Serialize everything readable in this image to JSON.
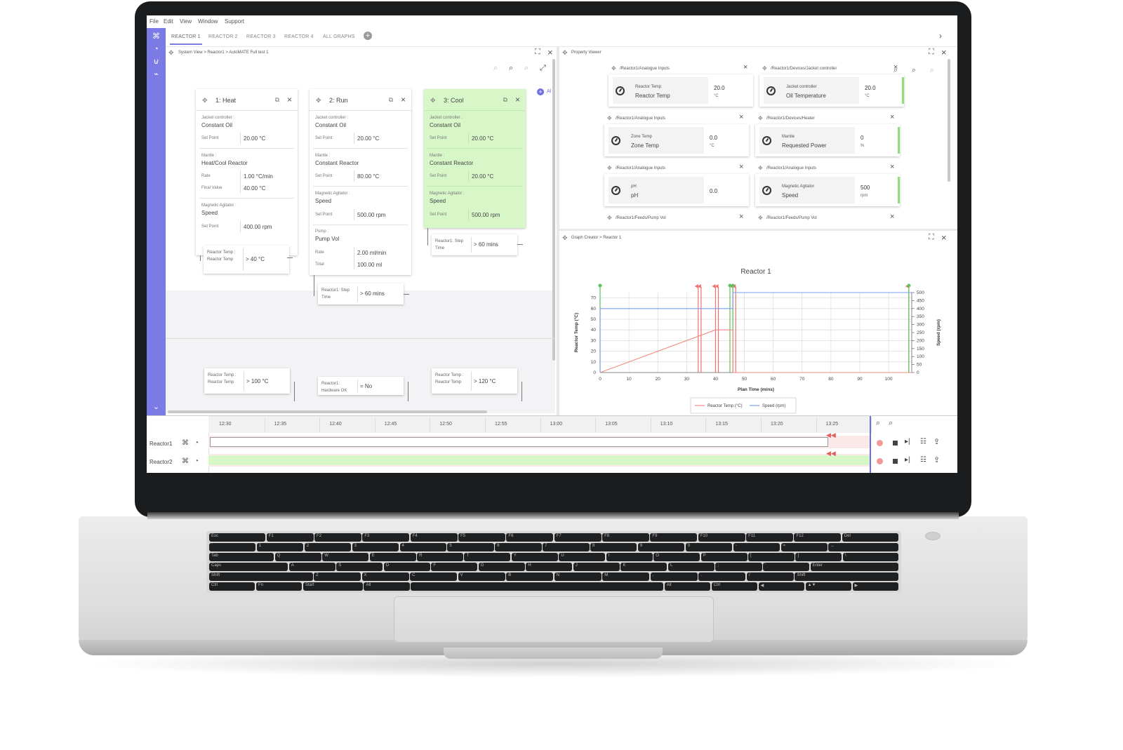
{
  "app": {
    "menu": [
      "File",
      "Edit",
      "View",
      "Window",
      "Support"
    ],
    "tabs": [
      "REACTOR 1",
      "REACTOR 2",
      "REACTOR 3",
      "REACTOR 4",
      "ALL GRAPHS"
    ],
    "active_tab": "REACTOR 1",
    "accent_color": "#7b7be6",
    "active_step_color": "#d8f7c9"
  },
  "system_view": {
    "breadcrumb": "System View > Reactor1 > AutoMATE Full test 1",
    "add_label": "Al",
    "steps": [
      {
        "title": "1: Heat",
        "sections": [
          {
            "device": "Jacket controller :",
            "mode": "Constant Oil",
            "rows": [
              {
                "label": "Set Point",
                "value": "20.00 °C"
              }
            ]
          },
          {
            "device": "Mantle :",
            "mode": "Heat/Cool Reactor",
            "rows": [
              {
                "label": "Rate",
                "value": "1.00 °C/min"
              },
              {
                "label": "Final Value",
                "value": "40.00 °C"
              }
            ]
          },
          {
            "device": "Magnetic Agitator :",
            "mode": "Speed",
            "rows": [
              {
                "label": "Set Point",
                "value": "400.00 rpm"
              }
            ]
          }
        ],
        "condition": {
          "label": "Reactor Temp : Reactor Temp",
          "value": "> 40 °C"
        }
      },
      {
        "title": "2: Run",
        "sections": [
          {
            "device": "Jacket controller :",
            "mode": "Constant Oil",
            "rows": [
              {
                "label": "Set Point",
                "value": "20.00 °C"
              }
            ]
          },
          {
            "device": "Mantle :",
            "mode": "Constant Reactor",
            "rows": [
              {
                "label": "Set Point",
                "value": "80.00 °C"
              }
            ]
          },
          {
            "device": "Magnetic Agitator :",
            "mode": "Speed",
            "rows": [
              {
                "label": "Set Point",
                "value": "500.00 rpm"
              }
            ]
          },
          {
            "device": "Pump :",
            "mode": "Pump Vol",
            "rows": [
              {
                "label": "Rate",
                "value": "2.00 ml/min"
              },
              {
                "label": "Total",
                "value": "100.00 ml"
              }
            ]
          }
        ],
        "condition": {
          "label": "Reactor1: Step Time",
          "value": "> 60 mins"
        }
      },
      {
        "title": "3: Cool",
        "sections": [
          {
            "device": "Jacket controller :",
            "mode": "Constant Oil",
            "rows": [
              {
                "label": "Set Point",
                "value": "20.00 °C"
              }
            ]
          },
          {
            "device": "Mantle :",
            "mode": "Constant Reactor",
            "rows": [
              {
                "label": "Set Point",
                "value": "20.00 °C"
              }
            ]
          },
          {
            "device": "Magnetic Agitator :",
            "mode": "Speed",
            "rows": [
              {
                "label": "Set Point",
                "value": "500.00 rpm"
              }
            ]
          }
        ],
        "condition": {
          "label": "Reactor1: Step Time",
          "value": "> 60 mins"
        }
      }
    ],
    "lower_conditions": [
      {
        "label": "Reactor Temp : Reactor Temp",
        "value": "> 100 °C"
      },
      {
        "label": "Reactor1: Hardware OK",
        "value": "= No"
      },
      {
        "label": "Reactor Temp : Reactor Temp",
        "value": "> 120 °C"
      }
    ]
  },
  "property_viewer": {
    "title": "Property Viewer",
    "cards": [
      {
        "path": "/Reactor1/Analogue Inputs",
        "device": "Reactor Temp",
        "property": "Reactor Temp",
        "value": "20.0",
        "unit": "°C"
      },
      {
        "path": "/Reactor1/Devices/Jacket controller",
        "device": "Jacket controller",
        "property": "Oil Temperature",
        "value": "20.0",
        "unit": "°C"
      },
      {
        "path": "/Reactor1/Analogue Inputs",
        "device": "Zone Temp",
        "property": "Zone Temp",
        "value": "0.0",
        "unit": "°C"
      },
      {
        "path": "/Reactor1/Devices/Heater",
        "device": "Mantle",
        "property": "Requested Power",
        "value": "0",
        "unit": "%"
      },
      {
        "path": "/Reactor1/Analogue Inputs",
        "device": "pH",
        "property": "pH",
        "value": "0.0",
        "unit": ""
      },
      {
        "path": "/Reactor1/Analogue Inputs",
        "device": "Magnetic Agitator",
        "property": "Speed",
        "value": "500",
        "unit": "rpm"
      },
      {
        "path": "/Reactor1/Feeds/Pump Vol",
        "device": "",
        "property": "",
        "value": "",
        "unit": ""
      },
      {
        "path": "/Reactor1/Feeds/Pump Vol",
        "device": "",
        "property": "",
        "value": "",
        "unit": ""
      }
    ]
  },
  "graph_creator": {
    "breadcrumb": "Graph Creator > Reactor 1"
  },
  "chart_data": {
    "type": "line",
    "title": "Reactor 1",
    "xlabel": "Plan Time (mins)",
    "ylabel": "Reactor Temp (°C)",
    "y2label": "Speed (rpm)",
    "xlim": [
      0,
      108
    ],
    "ylim": [
      0,
      75
    ],
    "y2lim": [
      0,
      500
    ],
    "xticks": [
      0,
      10,
      20,
      30,
      40,
      50,
      60,
      70,
      80,
      90,
      100
    ],
    "yticks": [
      0,
      10,
      20,
      30,
      40,
      50,
      60,
      70
    ],
    "y2ticks": [
      0,
      50,
      100,
      150,
      200,
      250,
      300,
      350,
      400,
      450,
      500
    ],
    "grid": true,
    "legend_position": "bottom",
    "series": [
      {
        "name": "Reactor Temp (°C)",
        "color": "#f28b82",
        "axis": "left",
        "x": [
          0,
          40,
          46,
          46,
          108
        ],
        "y": [
          0,
          40,
          40,
          0,
          0
        ]
      },
      {
        "name": "Speed (rpm)",
        "color": "#7b9ff0",
        "axis": "right",
        "x": [
          0,
          0,
          7,
          7,
          46,
          46,
          108
        ],
        "y": [
          0,
          400,
          400,
          400,
          400,
          500,
          500
        ]
      }
    ],
    "markers_red_x": [
      34,
      35,
      40,
      41,
      46,
      47,
      107
    ],
    "markers_green_x": [
      0,
      45,
      46,
      107
    ]
  },
  "timeline": {
    "ticks": [
      "12:30",
      "12:35",
      "12:40",
      "12:45",
      "12:50",
      "12:55",
      "13:00",
      "13:05",
      "13:10",
      "13:15",
      "13:20",
      "13:25"
    ],
    "rows": [
      {
        "label": "Reactor1",
        "progress": 0.94,
        "color": "#ffffff"
      },
      {
        "label": "Reactor2",
        "progress": 1.0,
        "color": "#d8f7c9"
      }
    ]
  },
  "keyboard": {
    "rows": [
      [
        "Esc",
        "F1",
        "F2",
        "F3",
        "F4",
        "F5",
        "F6",
        "F7",
        "F8",
        "F9",
        "F10",
        "F11",
        "F12",
        "Del"
      ],
      [
        "`",
        "1",
        "2",
        "3",
        "4",
        "5",
        "6",
        "7",
        "8",
        "9",
        "0",
        "-",
        "=",
        "←"
      ],
      [
        "Tab",
        "Q",
        "W",
        "E",
        "R",
        "T",
        "Y",
        "U",
        "I",
        "O",
        "P",
        "[",
        "]",
        "\\"
      ],
      [
        "Caps",
        "A",
        "S",
        "D",
        "F",
        "G",
        "H",
        "J",
        "K",
        "L",
        ";",
        "'",
        "Enter"
      ],
      [
        "Shift",
        "Z",
        "X",
        "C",
        "V",
        "B",
        "N",
        "M",
        ",",
        ".",
        "/",
        "Shift"
      ],
      [
        "Ctrl",
        "Fn",
        "Start",
        "Alt",
        "",
        "Alt",
        "Ctrl",
        "◀",
        "▲▼",
        "▶"
      ]
    ]
  }
}
